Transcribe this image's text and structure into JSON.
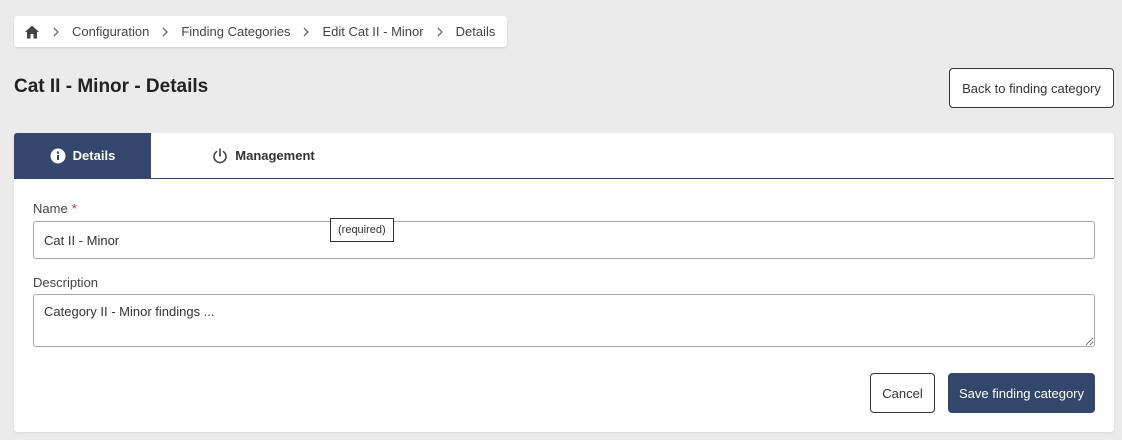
{
  "breadcrumb": {
    "home_icon": "home-icon",
    "items": [
      "Configuration",
      "Finding Categories",
      "Edit Cat II - Minor",
      "Details"
    ]
  },
  "page": {
    "title": "Cat II - Minor - Details",
    "back_label": "Back to finding category"
  },
  "tabs": [
    {
      "label": "Details",
      "icon": "info-icon",
      "active": true
    },
    {
      "label": "Management",
      "icon": "power-icon",
      "active": false
    }
  ],
  "form": {
    "name_label": "Name",
    "required_star": "*",
    "name_value": "Cat II - Minor",
    "required_tooltip": "(required)",
    "description_label": "Description",
    "description_value": "Category II - Minor findings ..."
  },
  "actions": {
    "cancel_label": "Cancel",
    "save_label": "Save finding category"
  },
  "colors": {
    "primary": "#33466b",
    "background": "#ebebeb",
    "required": "#c0392b"
  }
}
